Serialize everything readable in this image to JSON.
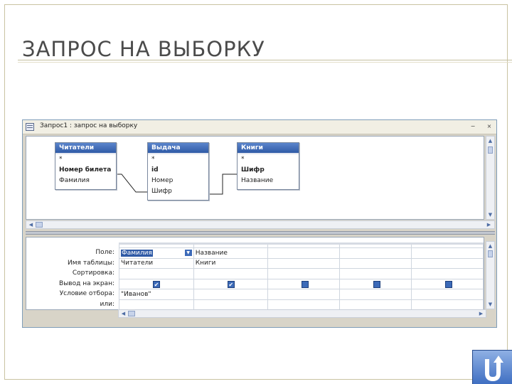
{
  "slide": {
    "title": "ЗАПРОС НА ВЫБОРКУ"
  },
  "window": {
    "title": "Запрос1 : запрос на выборку",
    "controls": {
      "minimize": "−",
      "close": "×"
    }
  },
  "tables": [
    {
      "name": "Читатели",
      "fields": [
        "*",
        "Номер билета",
        "Фамилия"
      ],
      "key_field": "Номер билета"
    },
    {
      "name": "Выдача",
      "fields": [
        "*",
        "id",
        "Номер",
        "Шифр"
      ],
      "key_field": "id"
    },
    {
      "name": "Книги",
      "fields": [
        "*",
        "Шифр",
        "Название"
      ],
      "key_field": "Шифр"
    }
  ],
  "grid": {
    "row_labels": [
      "Поле:",
      "Имя таблицы:",
      "Сортировка:",
      "Вывод на экран:",
      "Условие отбора:",
      "или:"
    ],
    "columns": [
      {
        "field": "Фамилия",
        "table": "Читатели",
        "sort": "",
        "show": true,
        "criteria": "\"Иванов\"",
        "or": ""
      },
      {
        "field": "Название",
        "table": "Книги",
        "sort": "",
        "show": true,
        "criteria": "",
        "or": ""
      },
      {
        "field": "",
        "table": "",
        "sort": "",
        "show": false,
        "criteria": "",
        "or": ""
      },
      {
        "field": "",
        "table": "",
        "sort": "",
        "show": false,
        "criteria": "",
        "or": ""
      },
      {
        "field": "",
        "table": "",
        "sort": "",
        "show": false,
        "criteria": "",
        "or": ""
      }
    ]
  },
  "icons": {
    "checkbox_mark": "✔",
    "dropdown": "▼",
    "nav_back": "return-arrow-icon"
  },
  "colors": {
    "accent": "#3c6ab8",
    "title_text": "#4b4b4b",
    "nav_button": "#3f6fc2"
  }
}
